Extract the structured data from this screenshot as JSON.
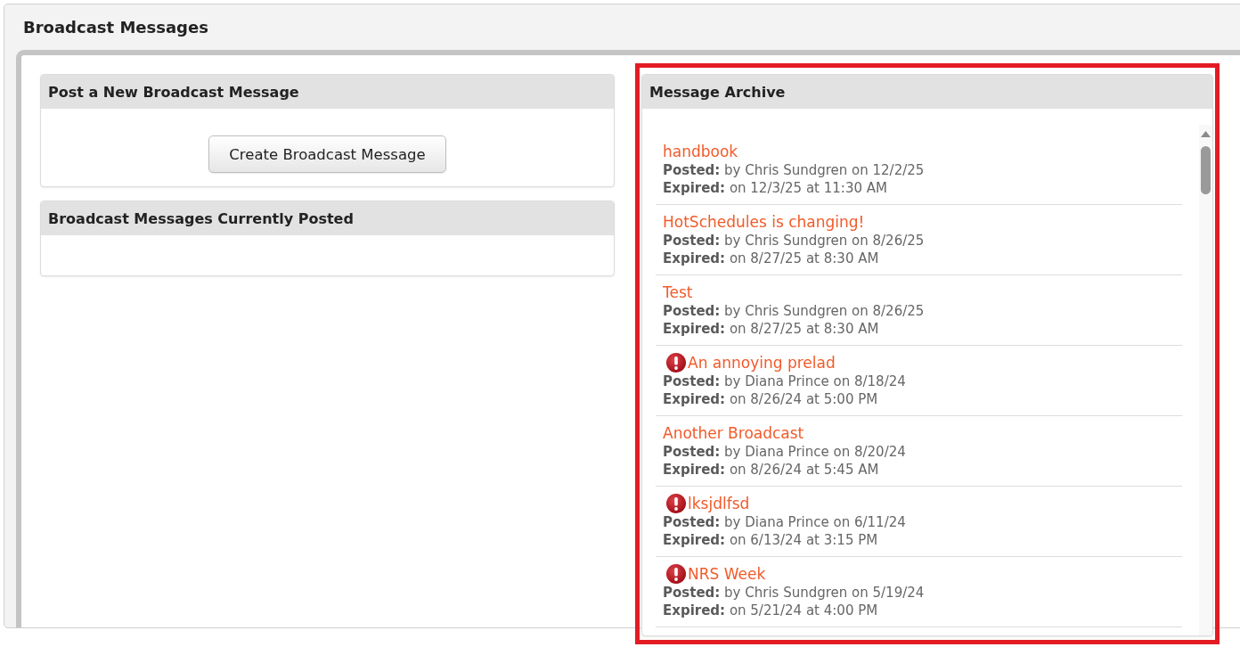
{
  "page": {
    "title": "Broadcast Messages"
  },
  "post_panel": {
    "title": "Post a New Broadcast Message",
    "button": "Create Broadcast Message"
  },
  "posted_panel": {
    "title": "Broadcast Messages Currently Posted"
  },
  "archive": {
    "title": "Message Archive",
    "messages": [
      {
        "title": "handbook",
        "urgent": false,
        "posted": "**Posted:** by Chris Sundgren on 12/2/25",
        "expired": "**Expired:** on 12/3/25 at 11:30 AM"
      },
      {
        "title": "HotSchedules is changing!",
        "urgent": false,
        "posted": "**Posted:** by Chris Sundgren on 8/26/25",
        "expired": "**Expired:** on 8/27/25 at 8:30 AM"
      },
      {
        "title": "Test",
        "urgent": false,
        "posted": "**Posted:** by Chris Sundgren on 8/26/25",
        "expired": "**Expired:** on 8/27/25 at 8:30 AM"
      },
      {
        "title": "An annoying prelad",
        "urgent": true,
        "posted": "**Posted:** by Diana Prince on 8/18/24",
        "expired": "**Expired:** on 8/26/24 at 5:00 PM"
      },
      {
        "title": "Another Broadcast",
        "urgent": false,
        "posted": "**Posted:** by Diana Prince on 8/20/24",
        "expired": "**Expired:** on 8/26/24 at 5:45 AM"
      },
      {
        "title": "lksjdlfsd",
        "urgent": true,
        "posted": "**Posted:** by Diana Prince on 6/11/24",
        "expired": "**Expired:** on 6/13/24 at 3:15 PM"
      },
      {
        "title": "NRS Week",
        "urgent": true,
        "posted": "**Posted:** by Chris Sundgren on 5/19/24",
        "expired": "**Expired:** on 5/21/24 at 4:00 PM"
      }
    ]
  }
}
